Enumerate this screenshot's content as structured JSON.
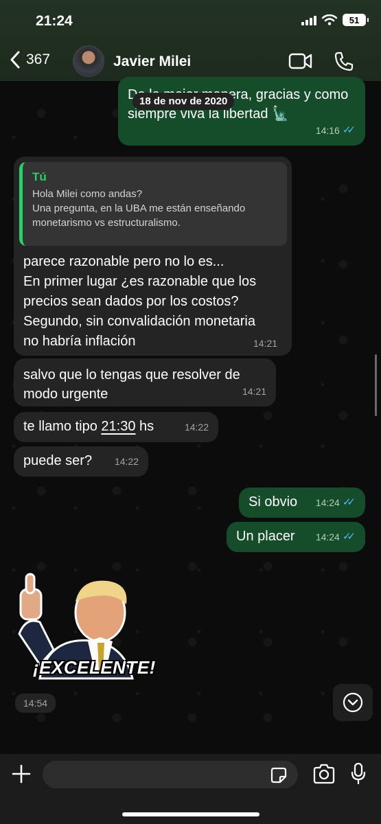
{
  "status_bar": {
    "time": "21:24",
    "battery": "51"
  },
  "header": {
    "back_count": "367",
    "contact_name": "Javier Milei"
  },
  "date_separator": "18 de nov de 2020",
  "messages": [
    {
      "direction": "outgoing",
      "text_line1": "De la mejor manera, gracias y como",
      "text_line2": "siempre viva la libertad 🗽",
      "time": "14:16",
      "status": "read"
    },
    {
      "direction": "incoming",
      "quote": {
        "author": "Tú",
        "line1": "Hola Milei como andas?",
        "line2": "Una pregunta, en la UBA me están enseñando",
        "line3": "monetarismo vs estructuralismo."
      },
      "lines": [
        "parece razonable pero no lo es...",
        "En primer lugar ¿es razonable que los",
        "precios sean dados por los costos?",
        "Segundo, sin convalidación monetaria",
        "no habría inflación"
      ],
      "time": "14:21"
    },
    {
      "direction": "incoming",
      "lines": [
        "salvo que lo tengas que resolver de",
        "modo urgente"
      ],
      "time": "14:21"
    },
    {
      "direction": "incoming",
      "text_prefix": "te llamo tipo ",
      "text_link": "21:30",
      "text_suffix": " hs",
      "time": "14:22"
    },
    {
      "direction": "incoming",
      "text": "puede ser?",
      "time": "14:22"
    },
    {
      "direction": "outgoing",
      "text": "Si obvio",
      "time": "14:24",
      "status": "read"
    },
    {
      "direction": "outgoing",
      "text": "Un placer",
      "time": "14:24",
      "status": "read"
    },
    {
      "direction": "incoming",
      "type": "sticker",
      "sticker_text": "¡EXCELENTE!",
      "time": "14:54"
    }
  ],
  "input": {
    "placeholder": ""
  },
  "colors": {
    "header_bg": "#233323",
    "incoming_bubble": "#242424",
    "outgoing_bubble": "#154d2a",
    "accent": "#25d366",
    "read_tick": "#4fb6ff"
  },
  "icons": [
    "back-chevron-icon",
    "video-call-icon",
    "phone-icon",
    "plus-icon",
    "sticker-icon",
    "camera-icon",
    "mic-icon",
    "chevron-down-icon"
  ]
}
